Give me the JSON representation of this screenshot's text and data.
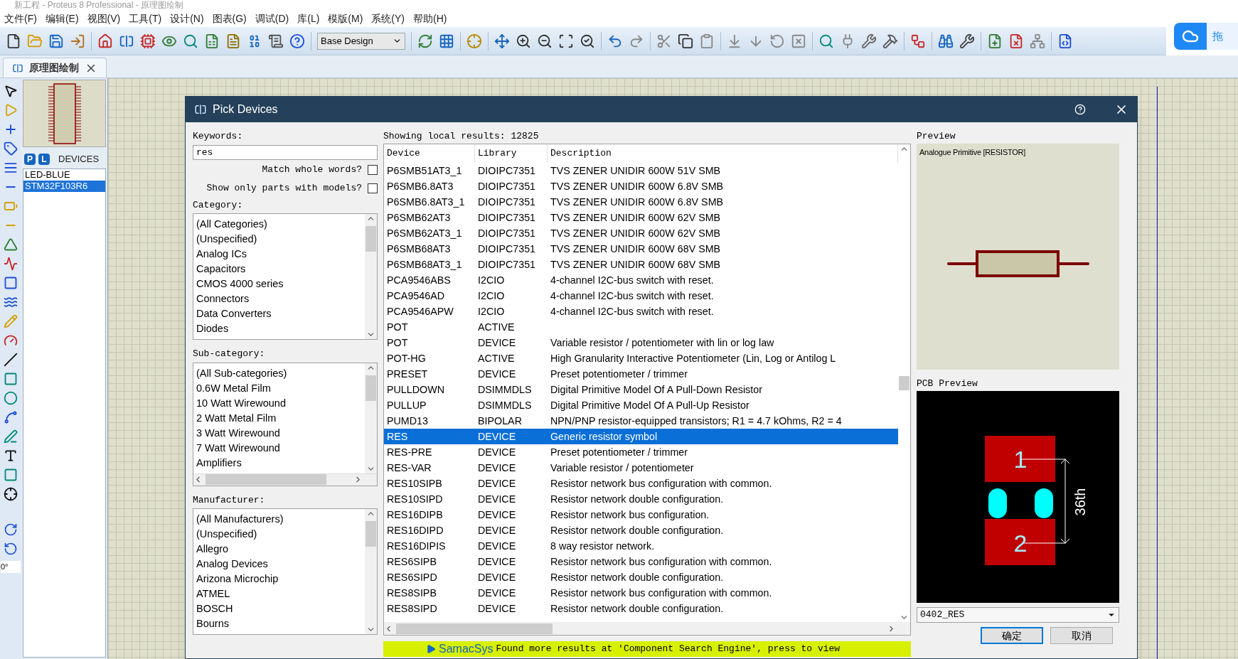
{
  "window": {
    "title": "新工程 - Proteus 8 Professional - 原理图绘制"
  },
  "menu": [
    "文件(F)",
    "编辑(E)",
    "视图(V)",
    "工具(T)",
    "设计(N)",
    "图表(G)",
    "调试(D)",
    "库(L)",
    "模版(M)",
    "系统(Y)",
    "帮助(H)"
  ],
  "toolbar": {
    "design_dropdown": "Base Design"
  },
  "cloud_widget": {
    "label": "拖"
  },
  "tabs": [
    {
      "label": "原理图绘制",
      "selected": true
    }
  ],
  "left_toolbar": {
    "rotation": "0°"
  },
  "device_panel": {
    "buttons": [
      "P",
      "L"
    ],
    "title": "DEVICES",
    "items": [
      {
        "label": "LED-BLUE",
        "selected": false
      },
      {
        "label": "STM32F103R6",
        "selected": true
      }
    ]
  },
  "dialog": {
    "title": "Pick Devices",
    "keywords": {
      "label": "Keywords:",
      "value": "res"
    },
    "options": [
      {
        "label": "Match whole words?",
        "checked": false
      },
      {
        "label": "Show only parts with models?",
        "checked": false
      }
    ],
    "category": {
      "label": "Category:",
      "items": [
        "(All Categories)",
        "(Unspecified)",
        "Analog ICs",
        "Capacitors",
        "CMOS 4000 series",
        "Connectors",
        "Data Converters",
        "Diodes"
      ]
    },
    "sub_category": {
      "label": "Sub-category:",
      "items": [
        "(All Sub-categories)",
        "0.6W Metal Film",
        "10 Watt Wirewound",
        "2 Watt Metal Film",
        "3 Watt Wirewound",
        "7 Watt Wirewound",
        "Amplifiers"
      ]
    },
    "manufacturer": {
      "label": "Manufacturer:",
      "items": [
        "(All Manufacturers)",
        "(Unspecified)",
        "Allegro",
        "Analog Devices",
        "Arizona Microchip",
        "ATMEL",
        "BOSCH",
        "Bourns"
      ]
    },
    "results_label": "Showing local results: 12825",
    "table": {
      "columns": [
        "Device",
        "Library",
        "Description"
      ],
      "rows": [
        {
          "device": "P6SMB51AT3_1",
          "library": "DIOIPC7351",
          "description": "TVS ZENER UNIDIR 600W 51V SMB",
          "selected": false
        },
        {
          "device": "P6SMB6.8AT3",
          "library": "DIOIPC7351",
          "description": "TVS ZENER UNIDIR 600W 6.8V SMB",
          "selected": false
        },
        {
          "device": "P6SMB6.8AT3_1",
          "library": "DIOIPC7351",
          "description": "TVS ZENER UNIDIR 600W 6.8V SMB",
          "selected": false
        },
        {
          "device": "P6SMB62AT3",
          "library": "DIOIPC7351",
          "description": "TVS ZENER UNIDIR 600W 62V SMB",
          "selected": false
        },
        {
          "device": "P6SMB62AT3_1",
          "library": "DIOIPC7351",
          "description": "TVS ZENER UNIDIR 600W 62V SMB",
          "selected": false
        },
        {
          "device": "P6SMB68AT3",
          "library": "DIOIPC7351",
          "description": "TVS ZENER UNIDIR 600W 68V SMB",
          "selected": false
        },
        {
          "device": "P6SMB68AT3_1",
          "library": "DIOIPC7351",
          "description": "TVS ZENER UNIDIR 600W 68V SMB",
          "selected": false
        },
        {
          "device": "PCA9546ABS",
          "library": "I2CIO",
          "description": "4-channel I2C-bus switch with reset.",
          "selected": false
        },
        {
          "device": "PCA9546AD",
          "library": "I2CIO",
          "description": "4-channel I2C-bus switch with reset.",
          "selected": false
        },
        {
          "device": "PCA9546APW",
          "library": "I2CIO",
          "description": "4-channel I2C-bus switch with reset.",
          "selected": false
        },
        {
          "device": "POT",
          "library": "ACTIVE",
          "selected": false
        },
        {
          "device": "POT",
          "library": "DEVICE",
          "description": "Variable resistor / potentiometer with lin or log law",
          "selected": false
        },
        {
          "device": "POT-HG",
          "library": "ACTIVE",
          "description": "High Granularity Interactive Potentiometer (Lin, Log or Antilog L",
          "selected": false
        },
        {
          "device": "PRESET",
          "library": "DEVICE",
          "description": "Preset potentiometer / trimmer",
          "selected": false
        },
        {
          "device": "PULLDOWN",
          "library": "DSIMMDLS",
          "description": "Digital Primitive Model Of A Pull-Down Resistor",
          "selected": false
        },
        {
          "device": "PULLUP",
          "library": "DSIMMDLS",
          "description": "Digital Primitive Model Of A Pull-Up Resistor",
          "selected": false
        },
        {
          "device": "PUMD13",
          "library": "BIPOLAR",
          "description": "NPN/PNP resistor-equipped transistors; R1 = 4.7 kOhms, R2 = 4",
          "selected": false
        },
        {
          "device": "RES",
          "library": "DEVICE",
          "description": "Generic resistor symbol",
          "selected": true
        },
        {
          "device": "RES-PRE",
          "library": "DEVICE",
          "description": "Preset potentiometer / trimmer",
          "selected": false
        },
        {
          "device": "RES-VAR",
          "library": "DEVICE",
          "description": "Variable resistor / potentiometer",
          "selected": false
        },
        {
          "device": "RES10SIPB",
          "library": "DEVICE",
          "description": "Resistor network bus configuration with common.",
          "selected": false
        },
        {
          "device": "RES10SIPD",
          "library": "DEVICE",
          "description": "Resistor network double configuration.",
          "selected": false
        },
        {
          "device": "RES16DIPB",
          "library": "DEVICE",
          "description": "Resistor network bus configuration.",
          "selected": false
        },
        {
          "device": "RES16DIPD",
          "library": "DEVICE",
          "description": "Resistor network double configuration.",
          "selected": false
        },
        {
          "device": "RES16DIPIS",
          "library": "DEVICE",
          "description": "8 way resistor network.",
          "selected": false
        },
        {
          "device": "RES6SIPB",
          "library": "DEVICE",
          "description": "Resistor network bus configuration with common.",
          "selected": false
        },
        {
          "device": "RES6SIPD",
          "library": "DEVICE",
          "description": "Resistor network double configuration.",
          "selected": false
        },
        {
          "device": "RES8SIPB",
          "library": "DEVICE",
          "description": "Resistor network bus configuration with common.",
          "selected": false
        },
        {
          "device": "RES8SIPD",
          "library": "DEVICE",
          "description": "Resistor network double configuration.",
          "selected": false
        }
      ]
    },
    "samacsys": {
      "brand": "SamacSys",
      "message": "Found more results at 'Component Search Engine', press to view"
    },
    "preview": {
      "label": "Preview",
      "caption": "Analogue Primitive [RESISTOR]"
    },
    "pcb_preview": {
      "label": "PCB Preview",
      "pads": [
        "1",
        "2"
      ],
      "dimension": "36th",
      "package": "0402_RES"
    },
    "buttons": [
      "确定",
      "取消"
    ]
  }
}
